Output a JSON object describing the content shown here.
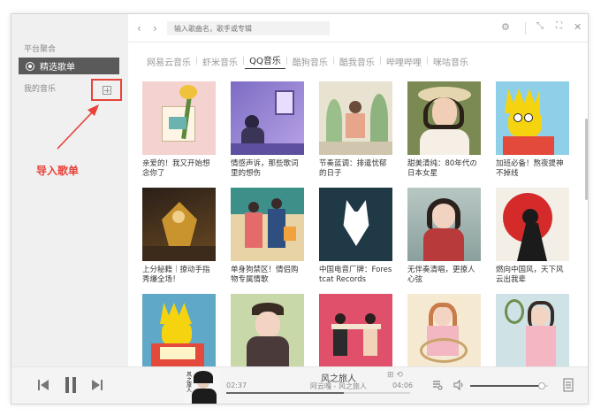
{
  "sidebar": {
    "section1": "平台聚合",
    "active_item": "精选歌单",
    "section2": "我的音乐"
  },
  "annotation": {
    "label": "导入歌单",
    "color": "#e8423a"
  },
  "search": {
    "placeholder": "输入歌曲名，歌手或专辑"
  },
  "tabs": [
    {
      "label": "网易云音乐",
      "active": false
    },
    {
      "label": "虾米音乐",
      "active": false
    },
    {
      "label": "QQ音乐",
      "active": true
    },
    {
      "label": "酷狗音乐",
      "active": false
    },
    {
      "label": "酷我音乐",
      "active": false
    },
    {
      "label": "哔哩哔哩",
      "active": false
    },
    {
      "label": "咪咕音乐",
      "active": false
    }
  ],
  "playlists": [
    {
      "title": "亲爱的！我又开始想念你了",
      "cover": "flower-art"
    },
    {
      "title": "情感声诉，那些歌词里的想伤",
      "cover": "purple-night"
    },
    {
      "title": "节奏蓝调：排遣忧郁的日子",
      "cover": "girl-plants"
    },
    {
      "title": "甜美清纯：80年代の日本女星",
      "cover": "woman-hat"
    },
    {
      "title": "加班必备！熬夜提神不掉线",
      "cover": "lisa-simpson"
    },
    {
      "title": "上分秘籍｜撩动手指秀爆全场！",
      "cover": "dark-hero"
    },
    {
      "title": "单身狗禁区！情侣购物专属情歌",
      "cover": "couple-shopping"
    },
    {
      "title": "中国电音厂牌：Forestcat Records",
      "cover": "white-fox"
    },
    {
      "title": "无伴奏清唱，更撩人心弦",
      "cover": "girl-scarf"
    },
    {
      "title": "燃向中国风，天下风云出我辈",
      "cover": "red-sun"
    },
    {
      "title": "",
      "cover": "lisa-reading"
    },
    {
      "title": "",
      "cover": "girl-beret"
    },
    {
      "title": "",
      "cover": "dinner-couple"
    },
    {
      "title": "",
      "cover": "girl-chair"
    },
    {
      "title": "",
      "cover": "tennis-girl"
    }
  ],
  "player": {
    "title": "风之旅人",
    "artist": "阿云嘎 - 风之旅人",
    "current_time": "02:37",
    "total_time": "04:06",
    "progress": 0.64,
    "volume": 0.92
  }
}
